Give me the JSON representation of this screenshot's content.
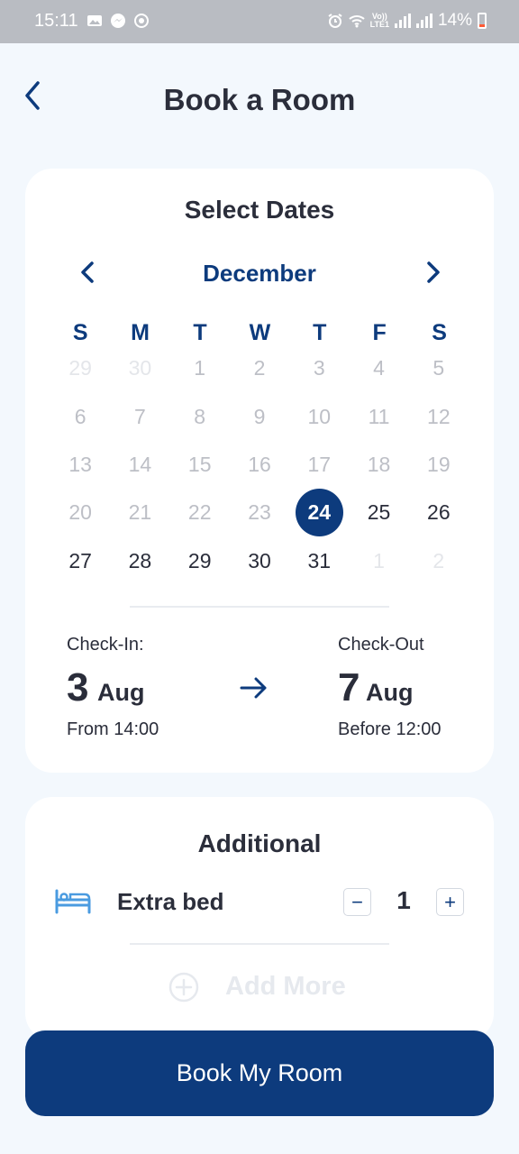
{
  "status_bar": {
    "time": "15:11",
    "battery_text": "14%",
    "network_label_top": "Vo))",
    "network_label_bottom": "LTE1"
  },
  "header": {
    "title": "Book a Room",
    "back_icon": "chevron-left-icon"
  },
  "dates_card": {
    "title": "Select Dates",
    "month": "December",
    "weekdays": [
      "S",
      "M",
      "T",
      "W",
      "T",
      "F",
      "S"
    ],
    "weeks": [
      [
        "29",
        "30",
        "1",
        "2",
        "3",
        "4",
        "5"
      ],
      [
        "6",
        "7",
        "8",
        "9",
        "10",
        "11",
        "12"
      ],
      [
        "13",
        "14",
        "15",
        "16",
        "17",
        "18",
        "19"
      ],
      [
        "20",
        "21",
        "22",
        "23",
        "24",
        "25",
        "26"
      ],
      [
        "27",
        "28",
        "29",
        "30",
        "31",
        "1",
        "2"
      ]
    ],
    "selected_day": "24",
    "check_in": {
      "label": "Check-In:",
      "day": "3",
      "month": "Aug",
      "time": "From 14:00"
    },
    "check_out": {
      "label": "Check-Out",
      "day": "7",
      "month": "Aug",
      "time": "Before 12:00"
    }
  },
  "additional_card": {
    "title": "Additional",
    "item_label": "Extra bed",
    "item_icon": "bed-icon",
    "quantity": "1",
    "decrement_label": "−",
    "increment_label": "+",
    "add_more_label": "Add More"
  },
  "book_button_label": "Book My Room",
  "colors": {
    "primary": "#0d3b7d",
    "background": "#f3f8fd",
    "card": "#ffffff",
    "muted_text": "#bdbfc6",
    "bed_icon": "#4a9be0"
  }
}
